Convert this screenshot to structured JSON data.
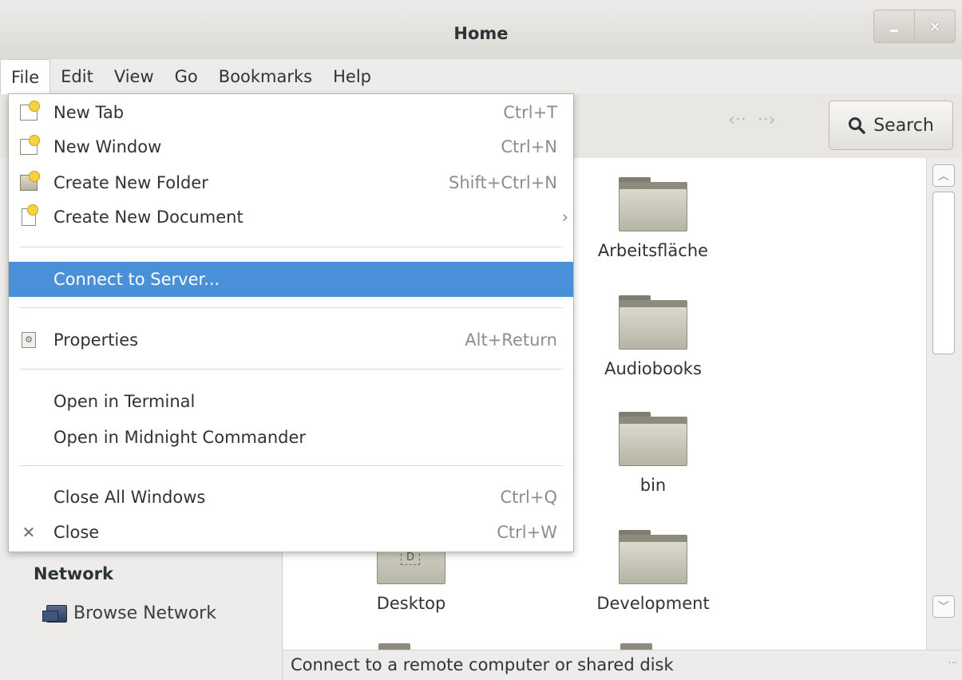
{
  "window": {
    "title": "Home",
    "controls": {
      "minimize": "_",
      "close": "×"
    }
  },
  "menubar": {
    "items": [
      {
        "label": "File"
      },
      {
        "label": "Edit"
      },
      {
        "label": "View"
      },
      {
        "label": "Go"
      },
      {
        "label": "Bookmarks"
      },
      {
        "label": "Help"
      }
    ]
  },
  "toolbar": {
    "back_icon": "back-arrow-icon",
    "forward_icon": "forward-arrow-icon",
    "search_label": "Search"
  },
  "file_menu": {
    "items": [
      {
        "label": "New Tab",
        "shortcut": "Ctrl+T",
        "icon": "new-tab-icon"
      },
      {
        "label": "New Window",
        "shortcut": "Ctrl+N",
        "icon": "new-window-icon"
      },
      {
        "label": "Create New Folder",
        "shortcut": "Shift+Ctrl+N",
        "icon": "folder-icon"
      },
      {
        "label": "Create New Document",
        "shortcut": "›",
        "icon": "document-icon"
      },
      {
        "label": "Connect to Server...",
        "shortcut": "",
        "selected": true
      },
      {
        "label": "Properties",
        "shortcut": "Alt+Return",
        "icon": "properties-icon"
      },
      {
        "label": "Open in Terminal",
        "shortcut": ""
      },
      {
        "label": "Open in Midnight Commander",
        "shortcut": ""
      },
      {
        "label": "Close All Windows",
        "shortcut": "Ctrl+Q"
      },
      {
        "label": "Close",
        "shortcut": "Ctrl+W",
        "icon": "close-icon"
      }
    ]
  },
  "sidebar": {
    "network_heading": "Network",
    "browse_network": "Browse Network"
  },
  "files": {
    "items": [
      {
        "name": "Arbeitsfläche"
      },
      {
        "name": "Audiobooks"
      },
      {
        "name": "bin"
      },
      {
        "name": "Desktop"
      },
      {
        "name": "Development"
      }
    ]
  },
  "statusbar": {
    "text": "Connect to a remote computer or shared disk"
  },
  "colors": {
    "selection": "#4a90d9",
    "background": "#edeceb",
    "content": "#ffffff"
  }
}
